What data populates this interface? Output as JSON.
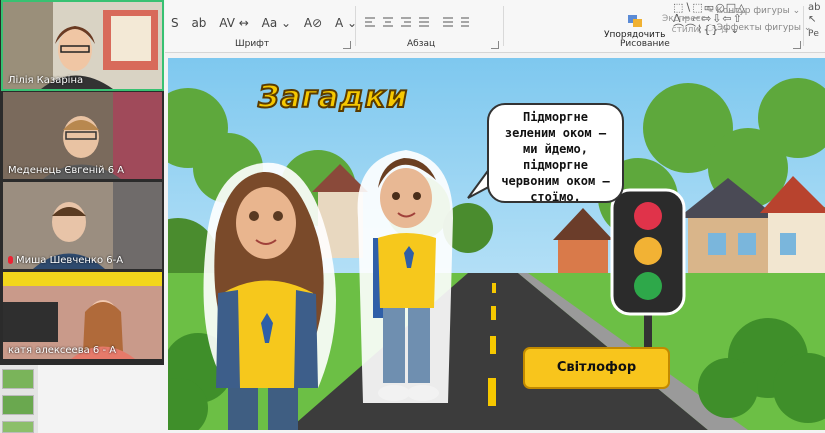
{
  "ribbon": {
    "font_tools": [
      "S",
      "ab",
      "AV ↔",
      "Aa ⌄",
      "A⊘",
      "A ⌄"
    ],
    "font_label": "Шрифт",
    "paragraph_label": "Абзац",
    "drawing_label": "Рисование",
    "arrange_label": "Упорядочить",
    "express_styles": "Экспресс-\nстили",
    "shape_outline": "Контур фигуры",
    "shape_effects": "Эффекты фигуры",
    "edit_label": "Ре"
  },
  "participants": [
    {
      "name": "Лілія Казаріна",
      "muted": false,
      "active": true
    },
    {
      "name": "Меденець Євгеній 6 А",
      "muted": false,
      "active": false
    },
    {
      "name": "Миша Шевченко 6-А",
      "muted": true,
      "active": false
    },
    {
      "name": "катя алексеева 6 - А",
      "muted": false,
      "active": false
    }
  ],
  "slide": {
    "title": "Загадки",
    "riddle": "Підморгне зеленим оком – ми йдемо, підморгне червоним оком — стоїмо.",
    "answer": "Світлофор"
  },
  "colors": {
    "title_fill": "#f6c800",
    "answer_bg": "#f8c51c",
    "active_speaker": "#38c172",
    "road": "#3c3c3c"
  }
}
